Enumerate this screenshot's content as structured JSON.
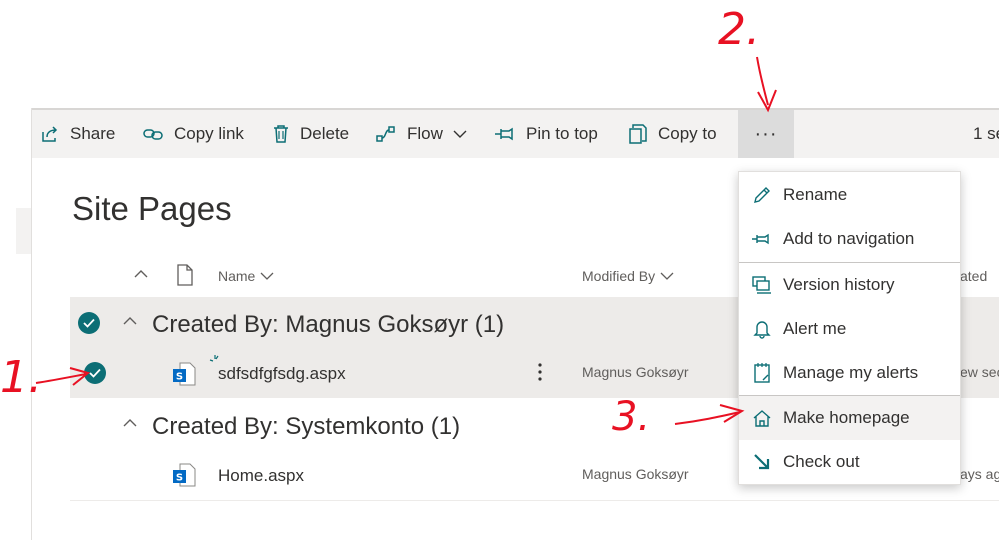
{
  "toolbar": {
    "share": "Share",
    "copy_link": "Copy link",
    "delete": "Delete",
    "flow": "Flow",
    "pin_to_top": "Pin to top",
    "copy_to": "Copy to",
    "more": "···",
    "selection_count": "1 se"
  },
  "page": {
    "title": "Site Pages"
  },
  "columns": {
    "name": "Name",
    "modified_by": "Modified By",
    "created": "ated"
  },
  "groups": [
    {
      "title": "Created By: Magnus Goksøyr (1)",
      "rows": [
        {
          "name": "sdfsdfgfsdg.aspx",
          "modified_by": "Magnus Goksøyr",
          "created": "ew sec"
        }
      ]
    },
    {
      "title": "Created By: Systemkonto (1)",
      "rows": [
        {
          "name": "Home.aspx",
          "modified_by": "Magnus Goksøyr",
          "created": "ays ag"
        }
      ]
    }
  ],
  "menu": {
    "items": [
      {
        "label": "Rename",
        "icon": "pencil-icon"
      },
      {
        "label": "Add to navigation",
        "icon": "pin-icon"
      },
      {
        "label": "Version history",
        "icon": "version-history-icon"
      },
      {
        "label": "Alert me",
        "icon": "bell-icon"
      },
      {
        "label": "Manage my alerts",
        "icon": "alerts-list-icon"
      },
      {
        "label": "Make homepage",
        "icon": "home-icon"
      },
      {
        "label": "Check out",
        "icon": "check-out-arrow-icon"
      }
    ]
  },
  "annotations": {
    "one": "1.",
    "two": "2.",
    "three": "3."
  },
  "colors": {
    "accent": "#0c6e75",
    "annotation": "#e81123",
    "selected_row": "#edebe9",
    "command_bar": "#f3f2f1"
  }
}
